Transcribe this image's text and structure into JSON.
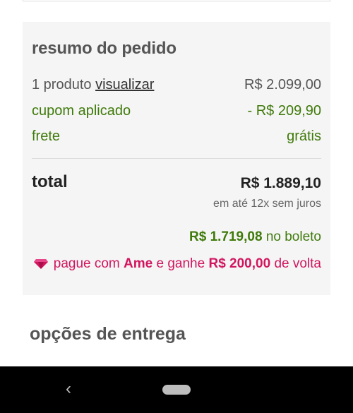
{
  "summary": {
    "title": "resumo do pedido",
    "products_count": "1 produto",
    "view_link": "visualizar",
    "products_price": "R$ 2.099,00",
    "coupon_label": "cupom aplicado",
    "coupon_value": "- R$ 209,90",
    "shipping_label": "frete",
    "shipping_value": "grátis",
    "total_label": "total",
    "total_value": "R$ 1.889,10",
    "installments": "em até 12x sem juros",
    "boleto_price": "R$ 1.719,08",
    "boleto_suffix": "no boleto",
    "ame_prefix": "pague com",
    "ame_brand": "Ame",
    "ame_middle": "e ganhe",
    "ame_cashback": "R$ 200,00",
    "ame_suffix": "de volta"
  },
  "delivery": {
    "title": "opções de entrega"
  },
  "navbar": {
    "back_icon": "‹"
  },
  "colors": {
    "accent_green": "#3f7a0a",
    "ame_pink": "#d1165f",
    "panel_bg": "#f5f5f5"
  },
  "icons": {
    "ame": "ame-gem-icon",
    "back": "back-icon",
    "home": "home-pill"
  }
}
